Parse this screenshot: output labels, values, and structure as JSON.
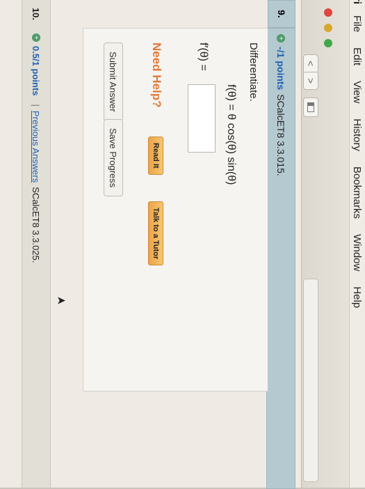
{
  "menubar": {
    "app": "ri",
    "items": [
      "File",
      "Edit",
      "View",
      "History",
      "Bookmarks",
      "Window",
      "Help"
    ]
  },
  "toolbar": {
    "back": "<",
    "forward": ">"
  },
  "question9": {
    "number": "9.",
    "points": "-/1 points",
    "ref": "SCalcET8 3.3.015.",
    "instruction": "Differentiate.",
    "equation": "f(θ) = θ cos(θ) sin(θ)",
    "answer_label": "f′(θ) =",
    "answer_value": "",
    "need_help": "Need Help?",
    "read_it": "Read It",
    "talk_to_tutor": "Talk to a Tutor",
    "submit": "Submit Answer",
    "save": "Save Progress"
  },
  "question10": {
    "number": "10.",
    "points": "0.5/1 points",
    "separator": "|",
    "previous": "Previous Answers",
    "ref": "SCalcET8 3.3.025."
  },
  "colors": {
    "accent_blue": "#1f62b0",
    "need_help_orange": "#e07a3a",
    "question_bar": "#b5c9d0"
  }
}
